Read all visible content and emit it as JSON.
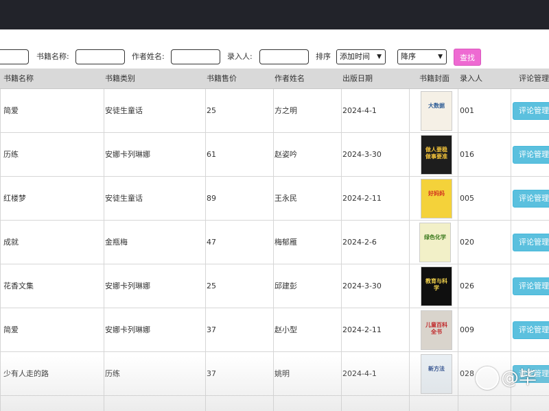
{
  "filters": {
    "name_label": "书籍名称:",
    "author_label": "作者姓名:",
    "enterer_label": "录入人:",
    "sort_label": "排序",
    "sort_field": "添加时间",
    "sort_order": "降序",
    "search_label": "查找",
    "accent": "#ee6ad2"
  },
  "table": {
    "columns": [
      "书籍名称",
      "书籍类别",
      "书籍售价",
      "作者姓名",
      "出版日期",
      "书籍封面",
      "录入人",
      "评论管理"
    ],
    "rows": [
      {
        "name": "简爱",
        "category": "安徒生童话",
        "price": "25",
        "author": "方之明",
        "date": "2024-4-1",
        "cover_text": "大数据",
        "enterer": "001",
        "action": "评论管理"
      },
      {
        "name": "历练",
        "category": "安娜卡列琳娜",
        "price": "61",
        "author": "赵姿吟",
        "date": "2024-3-30",
        "cover_text": "做人要稳 做事要准",
        "enterer": "016",
        "action": "评论管理"
      },
      {
        "name": "红楼梦",
        "category": "安徒生童话",
        "price": "89",
        "author": "王永民",
        "date": "2024-2-11",
        "cover_text": "好妈妈",
        "enterer": "005",
        "action": "评论管理"
      },
      {
        "name": "成就",
        "category": "金瓶梅",
        "price": "47",
        "author": "梅郁雁",
        "date": "2024-2-6",
        "cover_text": "绿色化学",
        "enterer": "020",
        "action": "评论管理"
      },
      {
        "name": "花香文集",
        "category": "安娜卡列琳娜",
        "price": "25",
        "author": "邱建彭",
        "date": "2024-3-30",
        "cover_text": "教育与科学",
        "enterer": "026",
        "action": "评论管理"
      },
      {
        "name": "简爱",
        "category": "安娜卡列琳娜",
        "price": "37",
        "author": "赵小型",
        "date": "2024-2-11",
        "cover_text": "儿童百科全书",
        "enterer": "009",
        "action": "评论管理"
      },
      {
        "name": "少有人走的路",
        "category": "历练",
        "price": "37",
        "author": "姚明",
        "date": "2024-4-1",
        "cover_text": "新方法",
        "enterer": "028",
        "action": "评论管理"
      }
    ]
  },
  "watermark": {
    "text": "@毕",
    "icon": "du-paw-icon"
  }
}
